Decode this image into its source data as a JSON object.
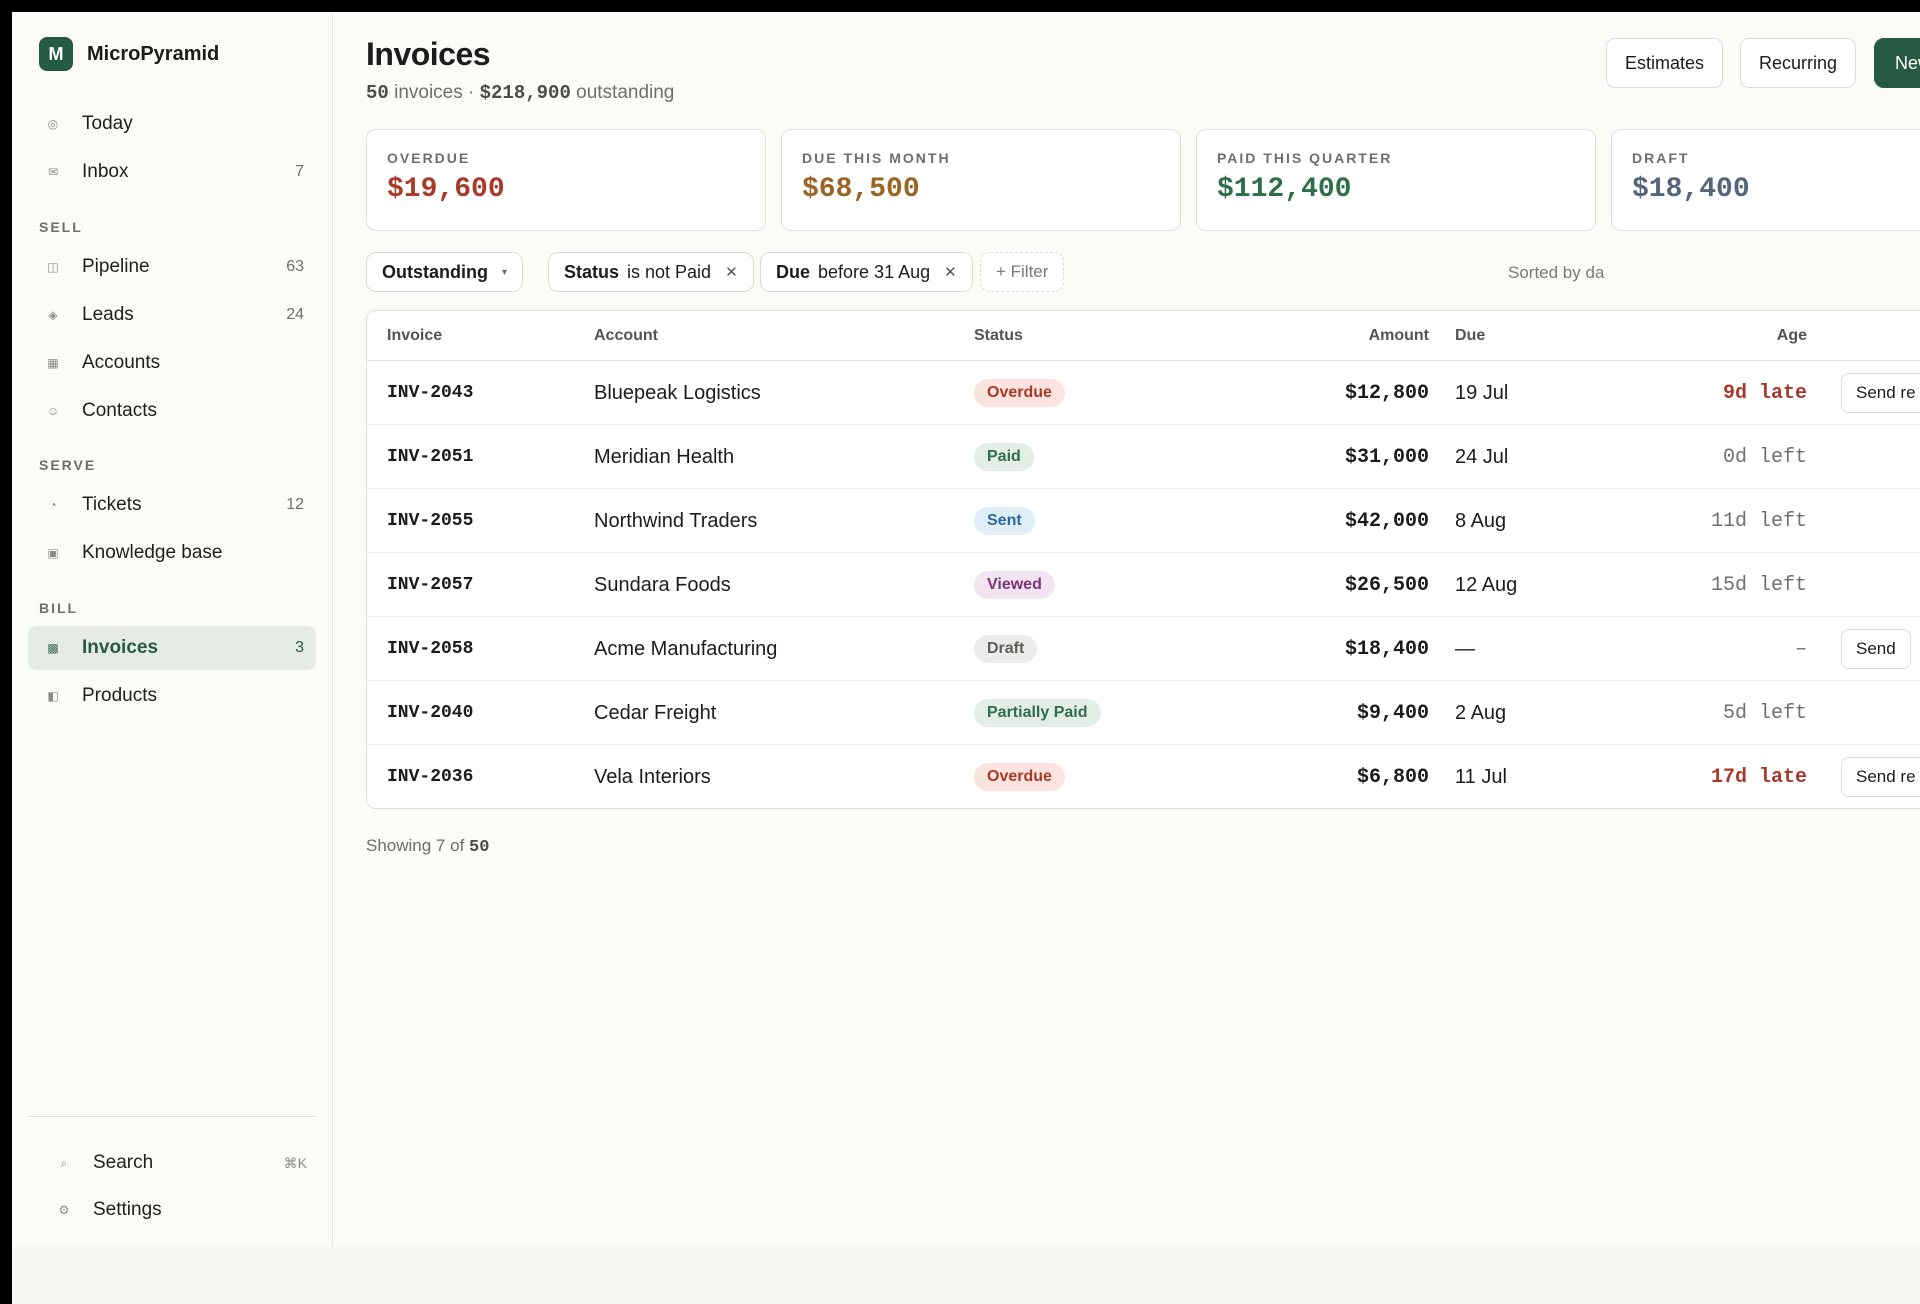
{
  "brand": {
    "logo_letter": "M",
    "name": "MicroPyramid"
  },
  "sidebar": {
    "top_items": [
      {
        "label": "Today",
        "icon": "circle-icon",
        "count": ""
      },
      {
        "label": "Inbox",
        "icon": "mail-icon",
        "count": "7"
      }
    ],
    "sections": [
      {
        "label": "SELL",
        "items": [
          {
            "label": "Pipeline",
            "icon": "pipeline-icon",
            "count": "63"
          },
          {
            "label": "Leads",
            "icon": "diamond-icon",
            "count": "24"
          },
          {
            "label": "Accounts",
            "icon": "square-icon",
            "count": ""
          },
          {
            "label": "Contacts",
            "icon": "contact-icon",
            "count": ""
          }
        ]
      },
      {
        "label": "SERVE",
        "items": [
          {
            "label": "Tickets",
            "icon": "clock-icon",
            "count": "12"
          },
          {
            "label": "Knowledge base",
            "icon": "book-icon",
            "count": ""
          }
        ]
      },
      {
        "label": "BILL",
        "items": [
          {
            "label": "Invoices",
            "icon": "invoice-icon",
            "count": "3",
            "active": true
          },
          {
            "label": "Products",
            "icon": "product-icon",
            "count": ""
          }
        ]
      }
    ],
    "footer": [
      {
        "label": "Search",
        "icon": "search-icon",
        "shortcut": "⌘K"
      },
      {
        "label": "Settings",
        "icon": "gear-icon",
        "shortcut": ""
      }
    ]
  },
  "header": {
    "title": "Invoices",
    "subtitle_count": "50",
    "subtitle_count_label": " invoices · ",
    "subtitle_amount": "$218,900",
    "subtitle_amount_label": " outstanding",
    "buttons": {
      "estimates": "Estimates",
      "recurring": "Recurring",
      "new": "New"
    }
  },
  "cards": [
    {
      "label": "OVERDUE",
      "value": "$19,600",
      "color": "#a83a2a"
    },
    {
      "label": "DUE THIS MONTH",
      "value": "$68,500",
      "color": "#9a6424"
    },
    {
      "label": "PAID THIS QUARTER",
      "value": "$112,400",
      "color": "#2f6e4a"
    },
    {
      "label": "DRAFT",
      "value": "$18,400",
      "color": "#55657a"
    }
  ],
  "filters": {
    "view": "Outstanding",
    "chips": [
      {
        "field": "Status",
        "value": "is not Paid"
      },
      {
        "field": "Due",
        "value": "before 31 Aug"
      }
    ],
    "add_filter": "+ Filter",
    "sorted": "Sorted by da"
  },
  "table": {
    "columns": {
      "invoice": "Invoice",
      "account": "Account",
      "status": "Status",
      "amount": "Amount",
      "due": "Due",
      "age": "Age"
    },
    "rows": [
      {
        "invoice": "INV-2043",
        "account": "Bluepeak Logistics",
        "status": "Overdue",
        "status_class": "b-overdue",
        "amount": "$12,800",
        "due": "19 Jul",
        "age": "9d late",
        "late": true,
        "action": "Send re"
      },
      {
        "invoice": "INV-2051",
        "account": "Meridian Health",
        "status": "Paid",
        "status_class": "b-paid",
        "amount": "$31,000",
        "due": "24 Jul",
        "age": "0d left",
        "late": false,
        "action": ""
      },
      {
        "invoice": "INV-2055",
        "account": "Northwind Traders",
        "status": "Sent",
        "status_class": "b-sent",
        "amount": "$42,000",
        "due": "8 Aug",
        "age": "11d left",
        "late": false,
        "action": ""
      },
      {
        "invoice": "INV-2057",
        "account": "Sundara Foods",
        "status": "Viewed",
        "status_class": "b-viewed",
        "amount": "$26,500",
        "due": "12 Aug",
        "age": "15d left",
        "late": false,
        "action": ""
      },
      {
        "invoice": "INV-2058",
        "account": "Acme Manufacturing",
        "status": "Draft",
        "status_class": "b-draft",
        "amount": "$18,400",
        "due": "—",
        "age": "–",
        "late": false,
        "action": "Send"
      },
      {
        "invoice": "INV-2040",
        "account": "Cedar Freight",
        "status": "Partially Paid",
        "status_class": "b-partial",
        "amount": "$9,400",
        "due": "2 Aug",
        "age": "5d left",
        "late": false,
        "action": ""
      },
      {
        "invoice": "INV-2036",
        "account": "Vela Interiors",
        "status": "Overdue",
        "status_class": "b-overdue",
        "amount": "$6,800",
        "due": "11 Jul",
        "age": "17d late",
        "late": true,
        "action": "Send re"
      }
    ]
  },
  "footer_note": {
    "prefix": "Showing 7 of ",
    "total": "50"
  }
}
